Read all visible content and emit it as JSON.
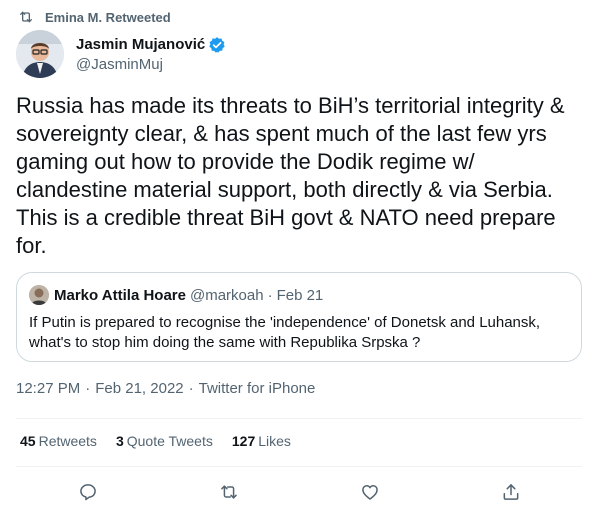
{
  "retweet_banner": {
    "text": "Emina M. Retweeted",
    "icon": "retweet-icon"
  },
  "author": {
    "name": "Jasmin Mujanović",
    "handle": "@JasminMuj",
    "verified": true,
    "verified_color": "#1d9bf0"
  },
  "tweet_text": "Russia has made its threats to BiH’s territorial integrity & sovereignty clear, & has spent much of the last few yrs gaming out how to provide the Dodik regime w/ clandestine material support, both directly & via Serbia. This is a credible threat BiH govt & NATO need prepare for.",
  "quote": {
    "name": "Marko Attila Hoare",
    "handle": "@markoah",
    "separator": "·",
    "date": "Feb 21",
    "text": "If Putin is prepared to recognise the 'independence' of Donetsk and Luhansk, what's to stop him doing the same with Republika Srpska ?"
  },
  "meta": {
    "time": "12:27 PM",
    "separator": "·",
    "date": "Feb 21, 2022",
    "source": "Twitter for iPhone"
  },
  "stats": {
    "retweets_count": "45",
    "retweets_label": "Retweets",
    "quotes_count": "3",
    "quotes_label": "Quote Tweets",
    "likes_count": "127",
    "likes_label": "Likes"
  },
  "actions": [
    "reply-icon",
    "retweet-icon",
    "like-icon",
    "share-icon"
  ],
  "colors": {
    "text": "#0f1419",
    "secondary": "#536471",
    "border": "#cfd9de",
    "divider": "#eff3f4"
  }
}
